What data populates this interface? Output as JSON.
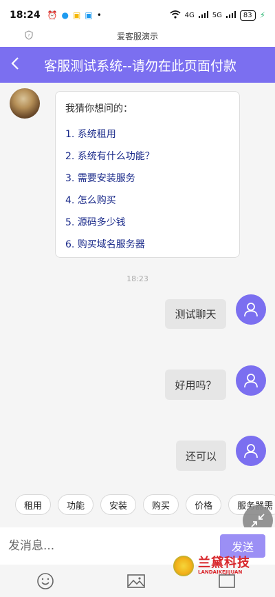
{
  "status_bar": {
    "time": "18:24",
    "network": "4G",
    "network2": "5G",
    "battery": "83"
  },
  "mini_title": "爱客服演示",
  "header": {
    "title": "客服测试系统--请勿在此页面付款"
  },
  "menu_card": {
    "hint": "我猜你想问的：",
    "items": [
      "1.  系统租用",
      "2.  系统有什么功能？",
      "3.  需要安装服务",
      "4.  怎么购买",
      "5.  源码多少钱",
      "6.  购买域名服务器"
    ]
  },
  "timestamp": "18:23",
  "messages": [
    "测试聊天",
    "好用吗？",
    "还可以"
  ],
  "quick_replies": [
    "租用",
    "功能",
    "安装",
    "购买",
    "价格",
    "服务器需"
  ],
  "input": {
    "placeholder": "发消息...",
    "value": ""
  },
  "send_label": "发送",
  "watermark": {
    "main": "兰黛科技",
    "sub": "LANDAIKEJIJUAN"
  },
  "colors": {
    "accent": "#7b6ff0",
    "send": "#9b8ff5",
    "menu_link": "#1a2a8a",
    "bubble": "#e6e6e6"
  }
}
